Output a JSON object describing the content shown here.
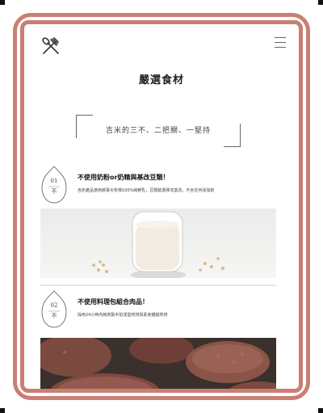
{
  "header": {
    "logo_icon": "fork-knife-icon",
    "menu_icon": "hamburger-menu-icon"
  },
  "page": {
    "title": "嚴選食材",
    "subtitle": "吉米的三不、二把關、一堅持"
  },
  "items": [
    {
      "number": "01",
      "label": "不",
      "title": "不使用奶粉or奶精與基改豆類！",
      "description": "含奶產品使用將軍大牧場100%純鮮乳，豆類飲選擇非基改，不含任何添加劑",
      "photo": "milk-glass-with-soybeans"
    },
    {
      "number": "02",
      "label": "不",
      "title": "不使用料理包組合肉品！",
      "description": "採用24小時內純肉製手拍漢堡肉排與素食雞腿肉排",
      "photo": "burger-patties"
    }
  ],
  "colors": {
    "frame": "#c97f73",
    "text": "#222222",
    "line": "#666666"
  }
}
